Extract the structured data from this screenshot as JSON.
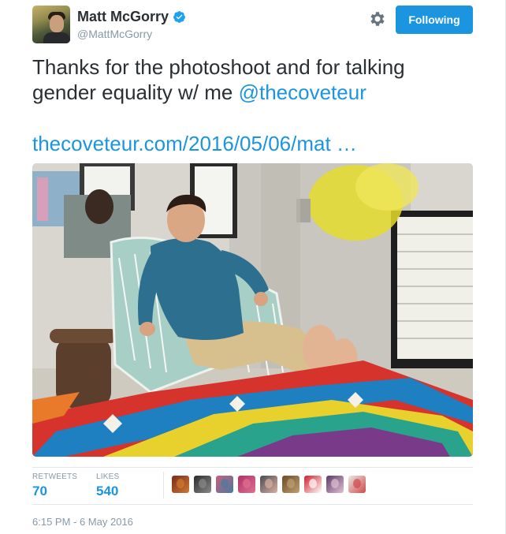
{
  "author": {
    "display_name": "Matt McGorry",
    "handle": "@MattMcGorry",
    "verified": true
  },
  "actions": {
    "follow_label": "Following"
  },
  "tweet": {
    "text_before": "Thanks for the photoshoot and for talking gender equality w/ me ",
    "mention": "@thecoveteur",
    "link": "thecoveteur.com/2016/05/06/mat …"
  },
  "stats": {
    "retweets_label": "RETWEETS",
    "retweets_value": "70",
    "likes_label": "LIKES",
    "likes_value": "540"
  },
  "likers": [
    {
      "colors": [
        "#7a2a1a",
        "#d07a30"
      ]
    },
    {
      "colors": [
        "#2a2a2a",
        "#8a8a8a"
      ]
    },
    {
      "colors": [
        "#c9607a",
        "#4a7aa0"
      ]
    },
    {
      "colors": [
        "#b0306a",
        "#e07090"
      ]
    },
    {
      "colors": [
        "#4a4a55",
        "#d8b0a0"
      ]
    },
    {
      "colors": [
        "#6a4a2a",
        "#c0a070"
      ]
    },
    {
      "colors": [
        "#d01e2a",
        "#ffffff"
      ]
    },
    {
      "colors": [
        "#5a3a6a",
        "#e0c0d0"
      ]
    },
    {
      "colors": [
        "#e8e8e8",
        "#d04a4a"
      ]
    }
  ],
  "timestamp": "6:15 PM - 6 May 2016",
  "colors": {
    "accent": "#1b95e0",
    "text": "#292f33",
    "muted": "#8899a6",
    "border": "#e1e8ed"
  }
}
